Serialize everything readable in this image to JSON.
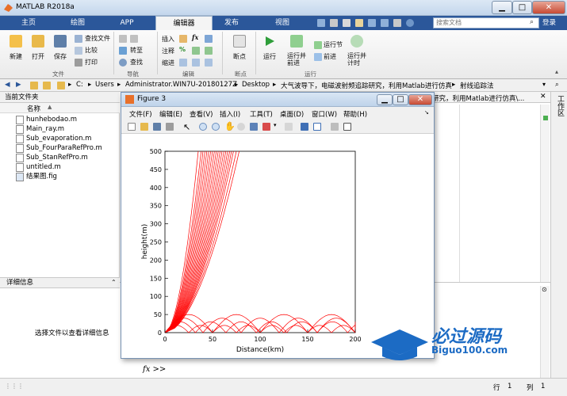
{
  "window": {
    "title": "MATLAB R2018a",
    "controls": {
      "minimize": "▁",
      "maximize": "□",
      "close": "✕"
    }
  },
  "tabs": [
    "主页",
    "绘图",
    "APP",
    "编辑器",
    "发布",
    "视图"
  ],
  "active_tab": "编辑器",
  "search": {
    "placeholder": "搜索文档",
    "login": "登录"
  },
  "ribbon": {
    "file_section": {
      "label": "文件",
      "new": "新建",
      "open": "打开",
      "save": "保存",
      "find_files": "查找文件",
      "compare": "比较",
      "print": "打印"
    },
    "nav_section": {
      "label": "导航",
      "goto": "转至",
      "find": "查找"
    },
    "edit_section": {
      "label": "编辑",
      "insert": "插入",
      "comment": "注释",
      "indent": "缩进",
      "fx": "fx",
      "percent": "%"
    },
    "breakpoints_section": {
      "label": "断点",
      "breakpoints": "断点"
    },
    "run_section": {
      "label": "运行",
      "run": "运行",
      "run_advance": "运行并\n前进",
      "run_section": "运行节",
      "advance": "前进",
      "run_time": "运行并\n计时"
    }
  },
  "address_bar": {
    "path": [
      "C:",
      "Users",
      "Administrator.WIN7U-20180127Z",
      "Desktop",
      "大气波导下，电磁波射频追踪研究，利用Matlab进行仿真",
      "射线追踪法"
    ]
  },
  "current_folder": {
    "header": "当前文件夹",
    "column": "名称",
    "files": [
      {
        "name": "hunhebodao.m",
        "icon": "m-file-icon"
      },
      {
        "name": "Main_ray.m",
        "icon": "m-file-icon"
      },
      {
        "name": "Sub_evaporation.m",
        "icon": "m-file-icon"
      },
      {
        "name": "Sub_FourParaRefPro.m",
        "icon": "m-file-icon"
      },
      {
        "name": "Sub_StanRefPro.m",
        "icon": "m-file-icon"
      },
      {
        "name": "untitled.m",
        "icon": "m-file-icon"
      },
      {
        "name": "结果图.fig",
        "icon": "fig-file-icon"
      }
    ]
  },
  "details": {
    "header": "详细信息",
    "message": "选择文件以查看详细信息"
  },
  "editor_tab_text": "研究，利用Matlab进行仿真\\...",
  "workspace_label": "工作区",
  "command_window": {
    "prompt": "fx >>"
  },
  "statusbar": {
    "row_label": "行",
    "row": "1",
    "col_label": "列",
    "col": "1"
  },
  "figure": {
    "title": "Figure 3",
    "menu": [
      "文件(F)",
      "编辑(E)",
      "查看(V)",
      "插入(I)",
      "工具(T)",
      "桌面(D)",
      "窗口(W)",
      "帮助(H)"
    ]
  },
  "chart_data": {
    "type": "line",
    "xlabel": "Distance(km)",
    "ylabel": "height(m)",
    "xlim": [
      0,
      200
    ],
    "ylim": [
      0,
      500
    ],
    "xticks": [
      0,
      50,
      100,
      150,
      200
    ],
    "yticks": [
      0,
      50,
      100,
      150,
      200,
      250,
      300,
      350,
      400,
      450,
      500
    ],
    "color": "#ff0000",
    "description_of_rays": {
      "escaping_rays_reach_top_at_x_km": [
        35,
        38,
        40,
        42,
        44,
        46,
        48,
        50,
        52,
        54,
        56,
        58,
        60,
        62,
        64,
        66,
        68,
        70,
        72,
        75,
        78
      ],
      "trapped_duct_rays": {
        "max_height_m": [
          20,
          30,
          40,
          50
        ],
        "half_period_km": [
          25,
          32,
          40,
          50
        ]
      }
    }
  },
  "watermark": {
    "text_top": "必过源码",
    "text_bottom": "Biguo100.com",
    "color": "#1c6bc4"
  }
}
